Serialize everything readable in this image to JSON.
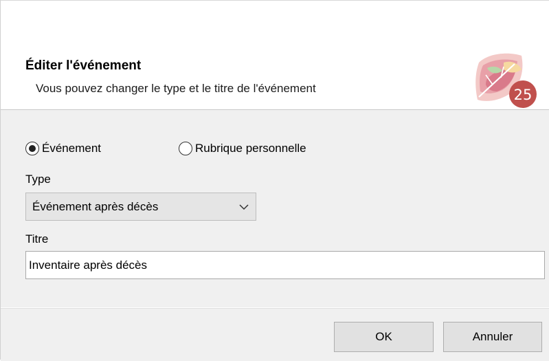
{
  "dialog": {
    "title": "Éditer l'événement",
    "subtitle": "Vous pouvez changer le type et le titre de l'événement",
    "logo_badge": "25"
  },
  "kind": {
    "options": [
      {
        "label": "Événement",
        "selected": true
      },
      {
        "label": "Rubrique personnelle",
        "selected": false
      }
    ]
  },
  "type_field": {
    "label": "Type",
    "value": "Événement après décès"
  },
  "title_field": {
    "label": "Titre",
    "value": "Inventaire après décès"
  },
  "buttons": {
    "ok": "OK",
    "cancel": "Annuler"
  },
  "colors": {
    "panel_bg": "#f0f0f0",
    "button_bg": "#e1e1e1",
    "logo_badge": "#c0504d"
  }
}
